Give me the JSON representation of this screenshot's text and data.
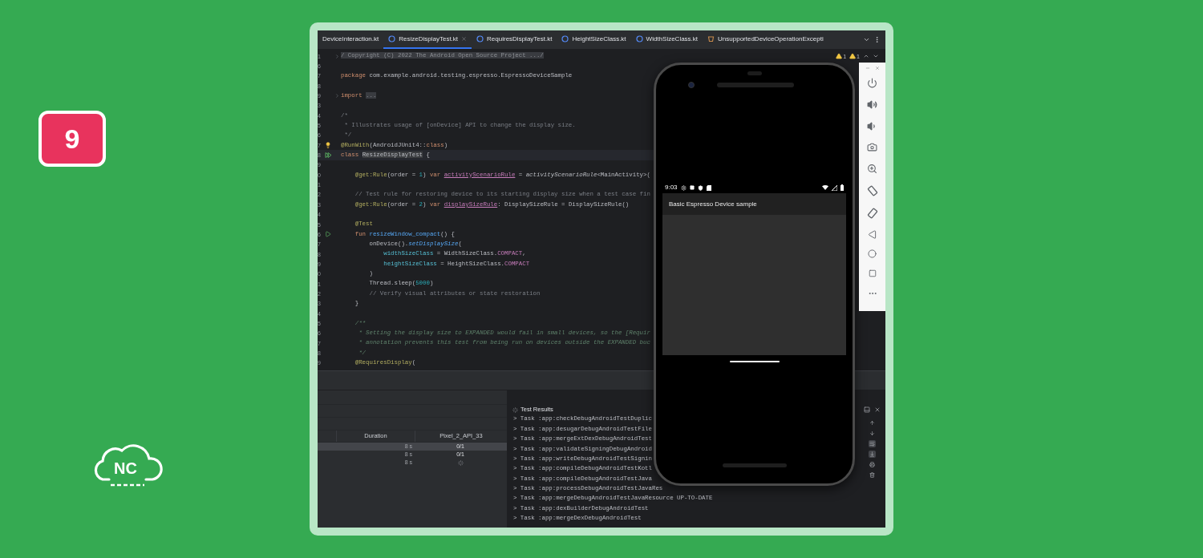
{
  "badge": {
    "label": "9"
  },
  "logo": {
    "label": "NC"
  },
  "ide": {
    "tabs": [
      {
        "label": "DeviceInteraction.kt",
        "selected": false
      },
      {
        "label": "ResizeDisplayTest.kt",
        "kind": "class",
        "selected": true
      },
      {
        "label": "RequiresDisplayTest.kt",
        "kind": "class",
        "selected": false
      },
      {
        "label": "HeightSizeClass.kt",
        "kind": "class",
        "selected": false
      },
      {
        "label": "WidthSizeClass.kt",
        "kind": "class",
        "selected": false
      },
      {
        "label": "UnsupportedDeviceOperationExcepti",
        "kind": "exception",
        "selected": false
      }
    ],
    "inspections": [
      {
        "count": "1"
      },
      {
        "count": "1"
      }
    ],
    "editor": {
      "lines": [
        {
          "number": "1",
          "kind": "fold",
          "current": false,
          "segments": [
            {
              "text": "/ Copyright (C) 2022 The Android Open Source Project .../",
              "kind": "folded"
            }
          ]
        },
        {
          "number": "6",
          "current": false
        },
        {
          "number": "7",
          "current": false,
          "segments": [
            {
              "text": "package ",
              "kind": "keyword"
            },
            {
              "text": "com.example.android.testing.espresso.EspressoDeviceSample",
              "kind": "plain"
            }
          ]
        },
        {
          "number": "8",
          "current": false
        },
        {
          "number": "9",
          "kind": "fold",
          "current": false,
          "segments": [
            {
              "text": "import ",
              "kind": "keyword"
            },
            {
              "text": "...",
              "kind": "folded"
            }
          ]
        },
        {
          "number": "3",
          "current": false
        },
        {
          "number": "4",
          "current": false,
          "segments": [
            {
              "text": "/*",
              "kind": "comment"
            }
          ]
        },
        {
          "number": "5",
          "current": false,
          "segments": [
            {
              "text": " * Illustrates usage of [onDevice] API to change the display size.",
              "kind": "comment"
            }
          ]
        },
        {
          "number": "6",
          "current": false,
          "segments": [
            {
              "text": " */",
              "kind": "comment"
            }
          ]
        },
        {
          "number": "7",
          "kind": "bulb",
          "current": false,
          "segments": [
            {
              "text": "@RunWith",
              "kind": "annotation"
            },
            {
              "text": "(AndroidJUnit4::",
              "kind": "plain"
            },
            {
              "text": "class",
              "kind": "keyword"
            },
            {
              "text": ")",
              "kind": "plain"
            }
          ]
        },
        {
          "number": "8",
          "kind": "run_all",
          "current": true,
          "segments": [
            {
              "text": "class ",
              "kind": "keyword"
            },
            {
              "text": "ResizeDisplayTest",
              "kind": "highlighted"
            },
            {
              "text": " {",
              "kind": "plain"
            }
          ]
        },
        {
          "number": "9",
          "current": false
        },
        {
          "number": "0",
          "current": false,
          "segments": [
            {
              "text": "    @get:Rule",
              "kind": "annotation"
            },
            {
              "text": "(order = ",
              "kind": "plain"
            },
            {
              "text": "1",
              "kind": "number"
            },
            {
              "text": ") ",
              "kind": "plain"
            },
            {
              "text": "var ",
              "kind": "keyword"
            },
            {
              "text": "activityScenarioRule",
              "kind": "field"
            },
            {
              "text": " = ",
              "kind": "plain"
            },
            {
              "text": "activityScenarioRule",
              "kind": "italic"
            },
            {
              "text": "<MainActivity>(",
              "kind": "plain"
            }
          ]
        },
        {
          "number": "1",
          "current": false
        },
        {
          "number": "2",
          "current": false,
          "segments": [
            {
              "text": "    // Test rule for restoring device to its starting display size when a test case fin",
              "kind": "comment"
            }
          ]
        },
        {
          "number": "3",
          "current": false,
          "segments": [
            {
              "text": "    @get:Rule",
              "kind": "annotation"
            },
            {
              "text": "(order = ",
              "kind": "plain"
            },
            {
              "text": "2",
              "kind": "number"
            },
            {
              "text": ") ",
              "kind": "plain"
            },
            {
              "text": "var ",
              "kind": "keyword"
            },
            {
              "text": "displaySizeRule",
              "kind": "field"
            },
            {
              "text": ": DisplaySizeRule = DisplaySizeRule()",
              "kind": "plain"
            }
          ]
        },
        {
          "number": "4",
          "current": false
        },
        {
          "number": "5",
          "current": false,
          "segments": [
            {
              "text": "    @Test",
              "kind": "annotation"
            }
          ]
        },
        {
          "number": "6",
          "kind": "run",
          "current": false,
          "segments": [
            {
              "text": "    fun ",
              "kind": "keyword"
            },
            {
              "text": "resizeWindow_compact",
              "kind": "declaration"
            },
            {
              "text": "() {",
              "kind": "plain"
            }
          ]
        },
        {
          "number": "7",
          "current": false,
          "segments": [
            {
              "text": "        onDevice().",
              "kind": "plain"
            },
            {
              "text": "setDisplaySize",
              "kind": "call"
            },
            {
              "text": "(",
              "kind": "plain"
            }
          ]
        },
        {
          "number": "8",
          "current": false,
          "segments": [
            {
              "text": "            widthSizeClass",
              "kind": "param"
            },
            {
              "text": " = WidthSizeClass.",
              "kind": "plain"
            },
            {
              "text": "COMPACT",
              "kind": "constant"
            },
            {
              "text": ",",
              "kind": "plain"
            }
          ]
        },
        {
          "number": "9",
          "current": false,
          "segments": [
            {
              "text": "            heightSizeClass",
              "kind": "param"
            },
            {
              "text": " = HeightSizeClass.",
              "kind": "plain"
            },
            {
              "text": "COMPACT",
              "kind": "constant"
            }
          ]
        },
        {
          "number": "0",
          "current": false,
          "segments": [
            {
              "text": "        )",
              "kind": "plain"
            }
          ]
        },
        {
          "number": "1",
          "current": false,
          "segments": [
            {
              "text": "        Thread.sleep(",
              "kind": "plain"
            },
            {
              "text": "5000",
              "kind": "number"
            },
            {
              "text": ")",
              "kind": "plain"
            }
          ]
        },
        {
          "number": "2",
          "current": false,
          "segments": [
            {
              "text": "        // Verify visual attributes or state restoration",
              "kind": "comment"
            }
          ]
        },
        {
          "number": "3",
          "current": false,
          "segments": [
            {
              "text": "    }",
              "kind": "plain"
            }
          ]
        },
        {
          "number": "4",
          "current": false
        },
        {
          "number": "5",
          "current": false,
          "segments": [
            {
              "text": "    /**",
              "kind": "doc"
            }
          ]
        },
        {
          "number": "6",
          "current": false,
          "segments": [
            {
              "text": "     * Setting the display size to EXPANDED would fail in small devices, so the [Requir",
              "kind": "doc"
            }
          ]
        },
        {
          "number": "7",
          "current": false,
          "segments": [
            {
              "text": "     * annotation prevents this test from being run on devices outside the EXPANDED buc",
              "kind": "doc"
            }
          ]
        },
        {
          "number": "8",
          "current": false,
          "segments": [
            {
              "text": "     */",
              "kind": "doc"
            }
          ]
        },
        {
          "number": "9",
          "current": false,
          "segments": [
            {
              "text": "    @RequiresDisplay",
              "kind": "annotation"
            },
            {
              "text": "(",
              "kind": "plain"
            }
          ]
        }
      ]
    },
    "test_table": {
      "columns": [
        "Duration",
        "Pixel_2_API_33"
      ],
      "rows": [
        {
          "kind": "count",
          "duration": "8 s",
          "result": "0/1",
          "selected": true
        },
        {
          "kind": "count",
          "duration": "8 s",
          "result": "0/1",
          "selected": false
        },
        {
          "kind": "running",
          "duration": "8 s",
          "selected": false
        }
      ]
    },
    "console": {
      "title": "Test Results",
      "lines": [
        "> Task :app:checkDebugAndroidTestDuplic",
        "> Task :app:desugarDebugAndroidTestFile",
        "> Task :app:mergeExtDexDebugAndroidTest",
        "> Task :app:validateSigningDebugAndroid",
        "> Task :app:writeDebugAndroidTestSignin",
        "> Task :app:compileDebugAndroidTestKotl",
        "> Task :app:compileDebugAndroidTestJava",
        "> Task :app:processDebugAndroidTestJavaRes",
        "> Task :app:mergeDebugAndroidTestJavaResource UP-TO-DATE",
        "> Task :app:dexBuilderDebugAndroidTest",
        "> Task :app:mergeDexDebugAndroidTest"
      ],
      "tools": [
        {
          "kind": "up",
          "selected": false
        },
        {
          "kind": "down",
          "selected": false
        },
        {
          "kind": "soft_wrap",
          "selected": true
        },
        {
          "kind": "scroll_to_end",
          "selected": true
        },
        {
          "kind": "print",
          "selected": false
        },
        {
          "kind": "delete",
          "selected": false
        }
      ]
    }
  },
  "emulator": {
    "time": "9:03",
    "app_title": "Basic Espresso Device sample",
    "tools": [
      {
        "kind": "power"
      },
      {
        "kind": "volume_up"
      },
      {
        "kind": "volume_down"
      },
      {
        "kind": "screenshot"
      },
      {
        "kind": "zoom"
      },
      {
        "kind": "rotate_left"
      },
      {
        "kind": "rotate_right"
      },
      {
        "kind": "back"
      },
      {
        "kind": "home"
      },
      {
        "kind": "overview"
      },
      {
        "kind": "more"
      }
    ]
  }
}
